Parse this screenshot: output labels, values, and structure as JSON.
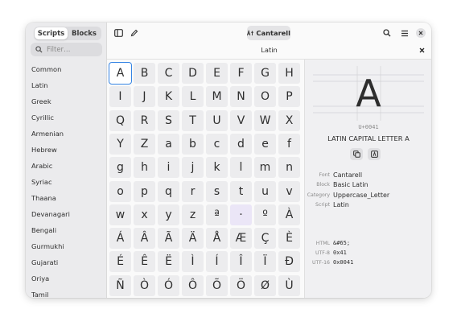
{
  "sidebar": {
    "tabs": [
      {
        "label": "Scripts",
        "active": true
      },
      {
        "label": "Blocks",
        "active": false
      }
    ],
    "filter_placeholder": "Filter…",
    "items": [
      "Common",
      "Latin",
      "Greek",
      "Cyrillic",
      "Armenian",
      "Hebrew",
      "Arabic",
      "Syriac",
      "Thaana",
      "Devanagari",
      "Bengali",
      "Gurmukhi",
      "Gujarati",
      "Oriya",
      "Tamil"
    ]
  },
  "header": {
    "font_button_label": "Cantarell",
    "icons": [
      "sidebar-toggle-icon",
      "pencil-icon",
      "font-icon",
      "search-icon",
      "menu-icon",
      "close-icon"
    ]
  },
  "content": {
    "title": "Latin"
  },
  "grid": {
    "selected": "A",
    "highlighted": "·",
    "rows": [
      [
        "A",
        "B",
        "C",
        "D",
        "E",
        "F",
        "G",
        "H"
      ],
      [
        "I",
        "J",
        "K",
        "L",
        "M",
        "N",
        "O",
        "P"
      ],
      [
        "Q",
        "R",
        "S",
        "T",
        "U",
        "V",
        "W",
        "X"
      ],
      [
        "Y",
        "Z",
        "a",
        "b",
        "c",
        "d",
        "e",
        "f"
      ],
      [
        "g",
        "h",
        "i",
        "j",
        "k",
        "l",
        "m",
        "n"
      ],
      [
        "o",
        "p",
        "q",
        "r",
        "s",
        "t",
        "u",
        "v"
      ],
      [
        "w",
        "x",
        "y",
        "z",
        "ª",
        "·",
        "º",
        "À"
      ],
      [
        "Á",
        "Â",
        "Ã",
        "Ä",
        "Å",
        "Æ",
        "Ç",
        "È"
      ],
      [
        "É",
        "Ê",
        "Ë",
        "Ì",
        "Í",
        "Î",
        "Ï",
        "Ð"
      ],
      [
        "Ñ",
        "Ò",
        "Ó",
        "Ô",
        "Õ",
        "Ö",
        "Ø",
        "Ù"
      ]
    ]
  },
  "detail": {
    "glyph": "A",
    "codepoint": "U+0041",
    "name": "LATIN CAPITAL LETTER A",
    "props": [
      {
        "label": "Font",
        "value": "Cantarell"
      },
      {
        "label": "Block",
        "value": "Basic Latin"
      },
      {
        "label": "Category",
        "value": "Uppercase_Letter"
      },
      {
        "label": "Script",
        "value": "Latin"
      }
    ],
    "encodings": [
      {
        "label": "HTML",
        "value": "&#65;"
      },
      {
        "label": "UTF-8",
        "value": "0x41"
      },
      {
        "label": "UTF-16",
        "value": "0x0041"
      }
    ],
    "accent_color": "#3584e4"
  }
}
